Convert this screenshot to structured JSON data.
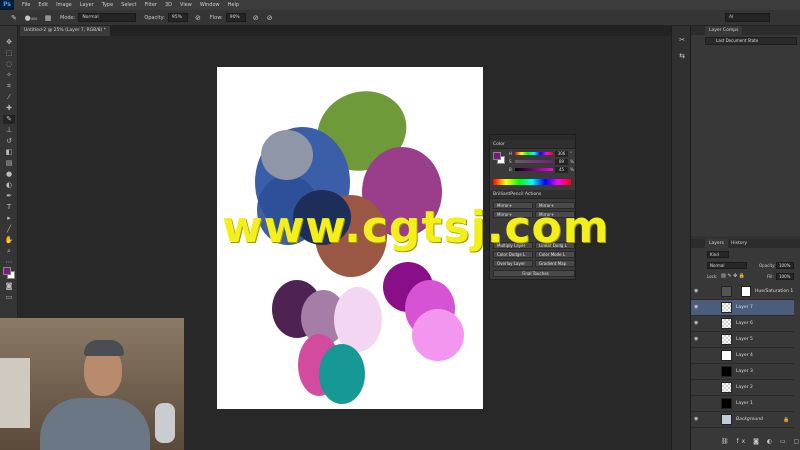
{
  "app": {
    "logo": "Ps",
    "menu": [
      "File",
      "Edit",
      "Image",
      "Layer",
      "Type",
      "Select",
      "Filter",
      "3D",
      "View",
      "Window",
      "Help"
    ]
  },
  "options_bar": {
    "brush_size": "400",
    "mode_label": "Mode:",
    "mode_value": "Normal",
    "opacity_label": "Opacity:",
    "opacity_value": "95%",
    "flow_label": "Flow:",
    "flow_value": "90%",
    "workspace_value": "AI"
  },
  "document_tab": {
    "title": "Untitled-2 @ 25% (Layer 7, RGB/8) *"
  },
  "color_panel": {
    "title": "Color",
    "channels": [
      {
        "label": "H",
        "value": "306"
      },
      {
        "label": "S",
        "value": "89"
      },
      {
        "label": "B",
        "value": "45"
      }
    ],
    "units": [
      "°",
      "%",
      "%"
    ]
  },
  "actions_panel": {
    "title": "BrilliantPencil Actions",
    "buttons": [
      "Mirror+",
      "Mirror+",
      "Mirror+",
      "Mirror+",
      "Multiply Layer",
      "Linear Dodg L",
      "Color Dodge L",
      "Color Mode L",
      "Overlay Layer",
      "Gradient Map"
    ],
    "wide_button": "Final Touches"
  },
  "layer_comps": {
    "title": "Layer Comps",
    "item": "Last Document State"
  },
  "layers_panel": {
    "tabs": [
      "Layers",
      "History"
    ],
    "filter_kind": "Kind",
    "blend_mode": "Normal",
    "opacity_label": "Opacity:",
    "opacity_value": "100%",
    "lock_label": "Lock:",
    "fill_label": "Fill:",
    "fill_value": "100%",
    "layers": [
      {
        "name": "Hue/Saturation 1"
      },
      {
        "name": "Layer 7"
      },
      {
        "name": "Layer 6"
      },
      {
        "name": "Layer 5"
      },
      {
        "name": "Layer 4"
      },
      {
        "name": "Layer 3"
      },
      {
        "name": "Layer 2"
      },
      {
        "name": "Layer 1"
      },
      {
        "name": "Background"
      }
    ]
  },
  "colors": {
    "foreground": "#7a1a7a",
    "background": "#ffffff",
    "watermark": "#f2ef1a"
  },
  "watermark_text": "www.cgtsj.com"
}
